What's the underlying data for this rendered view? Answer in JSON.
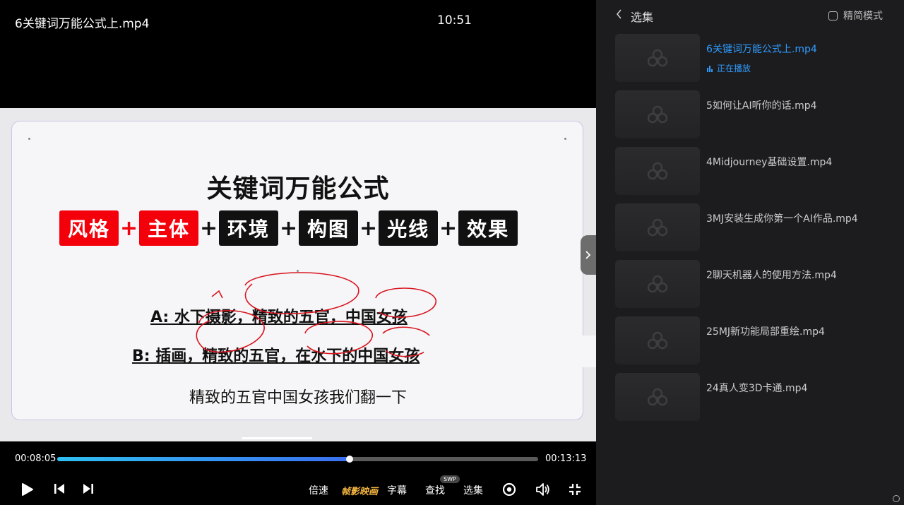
{
  "player": {
    "title": "6关键词万能公式上.mp4",
    "clock": "10:51"
  },
  "slide": {
    "title": "关键词万能公式",
    "formula": [
      {
        "label": "风格",
        "style": "red"
      },
      {
        "label": "主体",
        "style": "red"
      },
      {
        "label": "环境",
        "style": "dark"
      },
      {
        "label": "构图",
        "style": "dark"
      },
      {
        "label": "光线",
        "style": "dark"
      },
      {
        "label": "效果",
        "style": "dark"
      }
    ],
    "plus_sign": "+",
    "example_a": "A: 水下摄影，精致的五官，中国女孩",
    "example_b": "B: 插画，精致的五官，在水下的中国女孩"
  },
  "subtitle": "精致的五官中国女孩我们翻一下",
  "controls": {
    "time_current": "00:08:05",
    "time_total": "00:13:13",
    "progress": 0.608,
    "speed_label": "倍速",
    "zhenying_label": "帧影映画",
    "subtitle_label": "字幕",
    "find_label": "查找",
    "find_badge": "SWP",
    "episodes_label": "选集"
  },
  "panel": {
    "title": "选集",
    "simple_mode_label": "精简模式",
    "now_playing_label": "正在播放",
    "episodes": [
      {
        "title": "6关键词万能公式上.mp4",
        "active": true
      },
      {
        "title": "5如何让AI听你的话.mp4",
        "active": false
      },
      {
        "title": "4Midjourney基础设置.mp4",
        "active": false
      },
      {
        "title": "3MJ安装生成你第一个AI作品.mp4",
        "active": false
      },
      {
        "title": "2聊天机器人的使用方法.mp4",
        "active": false
      },
      {
        "title": "25MJ新功能局部重绘.mp4",
        "active": false
      },
      {
        "title": "24真人变3D卡通.mp4",
        "active": false
      }
    ]
  },
  "colors": {
    "accent": "#2f9bff",
    "formula_red": "#f4000a",
    "formula_dark": "#111111",
    "panel_bg": "#1c1c1e",
    "annotation_red": "#d9141e"
  },
  "icons": {
    "play": "play-icon",
    "prev": "skip-previous-icon",
    "next": "skip-next-icon",
    "danmaku": "danmaku-eye-icon",
    "volume": "volume-icon",
    "fullscreen": "exit-fullscreen-icon",
    "back": "chevron-left-icon",
    "thumbnail": "logo-placeholder-icon"
  }
}
